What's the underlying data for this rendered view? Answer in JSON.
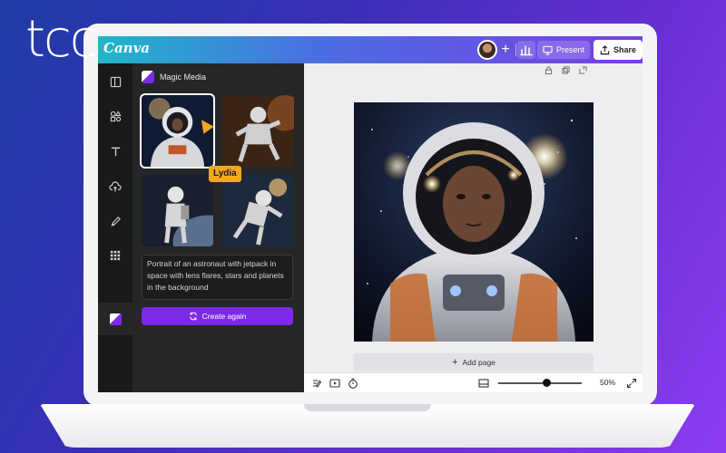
{
  "brand": {
    "logo_text": "tcc"
  },
  "app": {
    "name": "Canva"
  },
  "topbar": {
    "present_label": "Present",
    "share_label": "Share"
  },
  "rail": {
    "items": [
      "layout-icon",
      "elements-icon",
      "text-icon",
      "uploads-icon",
      "draw-icon",
      "apps-icon",
      "magic-media-icon"
    ]
  },
  "panel": {
    "title": "Magic Media",
    "prompt": "Portrait of an astronaut with jetpack in space with lens flares, stars and planets in the background",
    "create_again_label": "Create again",
    "collaborator_name": "Lydia"
  },
  "canvas": {
    "add_page_label": "Add page"
  },
  "bottombar": {
    "zoom": "50%",
    "zoom_fraction": 0.55
  },
  "colors": {
    "accent": "#7d2ae8",
    "cursor": "#f5a623",
    "panel_bg": "#252627",
    "rail_bg": "#18191b"
  }
}
